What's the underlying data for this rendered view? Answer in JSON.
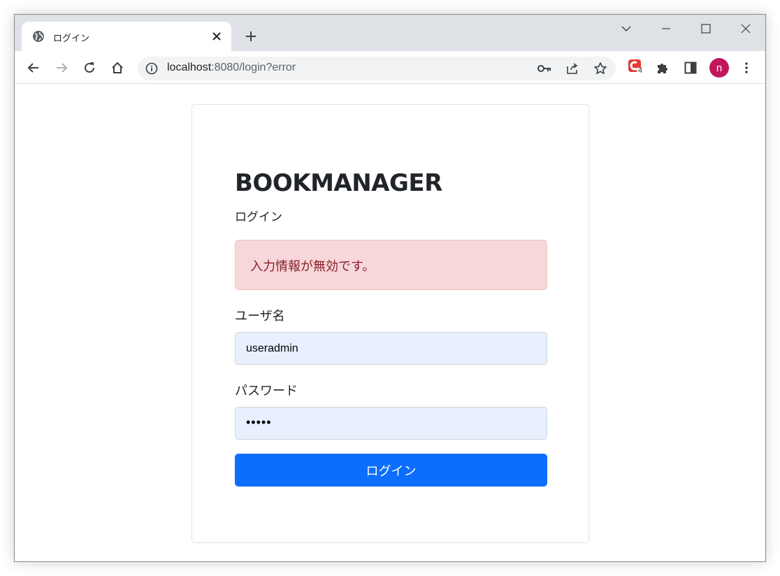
{
  "browser": {
    "tab_title": "ログイン",
    "url_host": "localhost",
    "url_rest": ":8080/login?error",
    "extension_badge_count": "4",
    "profile_initial": "n",
    "icons": [
      "globe-icon",
      "close-icon",
      "plus-icon",
      "chevron-down-icon",
      "minimize-icon",
      "maximize-icon",
      "window-close-icon",
      "back-icon",
      "forward-icon",
      "reload-icon",
      "home-icon",
      "info-icon",
      "key-icon",
      "share-icon",
      "star-icon",
      "extension-icon",
      "puzzle-icon",
      "side-panel-icon",
      "more-vert-icon"
    ]
  },
  "login": {
    "brand": "BOOKMANAGER",
    "subtitle": "ログイン",
    "error_message": "入力情報が無効です。",
    "username_label": "ユーザ名",
    "username_value": "useradmin",
    "password_label": "パスワード",
    "password_value": "•••••",
    "submit_label": "ログイン"
  },
  "colors": {
    "primary": "#0d6efd",
    "alert_bg": "#f8d7da",
    "alert_text": "#842029",
    "autofill_bg": "#e8f0fe",
    "avatar": "#c2185b"
  }
}
